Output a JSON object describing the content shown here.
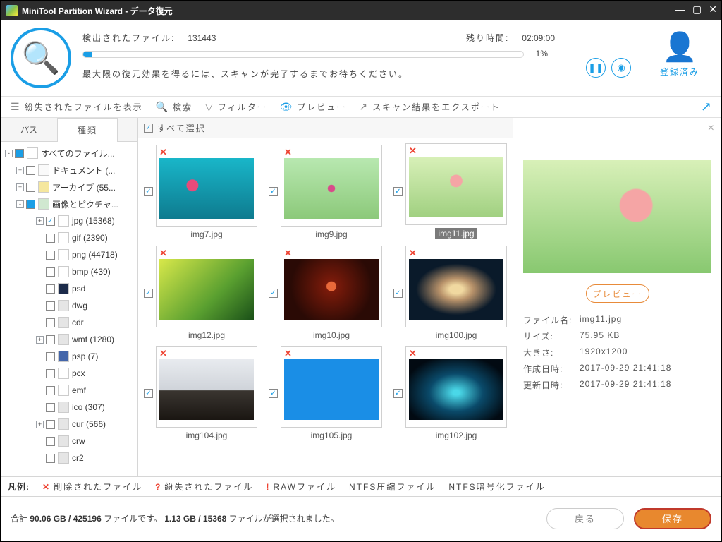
{
  "window": {
    "title": "MiniTool Partition Wizard - データ復元"
  },
  "scan": {
    "foundLabel": "検出されたファイル:",
    "foundCount": "131443",
    "remainingLabel": "残り時間:",
    "remainingTime": "02:09:00",
    "percent": "1%",
    "desc": "最大限の復元効果を得るには、スキャンが完了するまでお待ちください。"
  },
  "user": {
    "label": "登録済み"
  },
  "toolbar": {
    "lost": "紛失されたファイルを表示",
    "search": "検索",
    "filter": "フィルター",
    "preview": "プレビュー",
    "export": "スキャン結果をエクスポート"
  },
  "tabs": {
    "path": "パス",
    "type": "種類"
  },
  "tree": [
    {
      "l": 0,
      "exp": "-",
      "cb": "part",
      "ico": "pc",
      "t": "すべてのファイル..."
    },
    {
      "l": 1,
      "exp": "+",
      "cb": "",
      "ico": "doc",
      "t": "ドキュメント (..."
    },
    {
      "l": 1,
      "exp": "+",
      "cb": "",
      "ico": "arch",
      "t": "アーカイブ (55..."
    },
    {
      "l": 1,
      "exp": "-",
      "cb": "part",
      "ico": "img",
      "t": "画像とピクチャ..."
    },
    {
      "l": 2,
      "exp": "+",
      "cb": "chk",
      "ico": "jpg",
      "t": "jpg (15368)"
    },
    {
      "l": 2,
      "exp": " ",
      "cb": "",
      "ico": "gif",
      "t": "gif (2390)"
    },
    {
      "l": 2,
      "exp": " ",
      "cb": "",
      "ico": "png",
      "t": "png (44718)"
    },
    {
      "l": 2,
      "exp": " ",
      "cb": "",
      "ico": "bmp",
      "t": "bmp (439)"
    },
    {
      "l": 2,
      "exp": " ",
      "cb": "",
      "ico": "psd",
      "t": "psd"
    },
    {
      "l": 2,
      "exp": " ",
      "cb": "",
      "ico": "",
      "t": "dwg"
    },
    {
      "l": 2,
      "exp": " ",
      "cb": "",
      "ico": "",
      "t": "cdr"
    },
    {
      "l": 2,
      "exp": "+",
      "cb": "",
      "ico": "",
      "t": "wmf (1280)"
    },
    {
      "l": 2,
      "exp": " ",
      "cb": "",
      "ico": "psp",
      "t": "psp (7)"
    },
    {
      "l": 2,
      "exp": " ",
      "cb": "",
      "ico": "pcx",
      "t": "pcx"
    },
    {
      "l": 2,
      "exp": " ",
      "cb": "",
      "ico": "emf",
      "t": "emf"
    },
    {
      "l": 2,
      "exp": " ",
      "cb": "",
      "ico": "",
      "t": "ico (307)"
    },
    {
      "l": 2,
      "exp": "+",
      "cb": "",
      "ico": "",
      "t": "cur (566)"
    },
    {
      "l": 2,
      "exp": " ",
      "cb": "",
      "ico": "",
      "t": "crw"
    },
    {
      "l": 2,
      "exp": " ",
      "cb": "",
      "ico": "",
      "t": "cr2"
    }
  ],
  "selectAll": "すべて選択",
  "thumbs": [
    [
      {
        "n": "img7.jpg",
        "g": "g1"
      },
      {
        "n": "img9.jpg",
        "g": "g2"
      },
      {
        "n": "img11.jpg",
        "g": "g3",
        "sel": true
      }
    ],
    [
      {
        "n": "img12.jpg",
        "g": "g4"
      },
      {
        "n": "img10.jpg",
        "g": "g5"
      },
      {
        "n": "img100.jpg",
        "g": "g6"
      }
    ],
    [
      {
        "n": "img104.jpg",
        "g": "g7"
      },
      {
        "n": "img105.jpg",
        "g": "g8"
      },
      {
        "n": "img102.jpg",
        "g": "g9"
      }
    ]
  ],
  "preview": {
    "btn": "プレビュー",
    "meta": {
      "nameK": "ファイル名:",
      "nameV": "img11.jpg",
      "sizeK": "サイズ:",
      "sizeV": "75.95 KB",
      "dimK": "大きさ:",
      "dimV": "1920x1200",
      "ctK": "作成日時:",
      "ctV": "2017-09-29 21:41:18",
      "mtK": "更新日時:",
      "mtV": "2017-09-29 21:41:18"
    }
  },
  "legend": {
    "key": "凡例:",
    "deleted": "削除されたファイル",
    "lost": "紛失されたファイル",
    "raw": "RAWファイル",
    "ntfsC": "NTFS圧縮ファイル",
    "ntfsE": "NTFS暗号化ファイル"
  },
  "footer": {
    "stats": "合計 <b>90.06 GB / 425196</b> ファイルです。 <b>1.13 GB / 15368</b> ファイルが選択されました。",
    "back": "戻る",
    "save": "保存"
  }
}
